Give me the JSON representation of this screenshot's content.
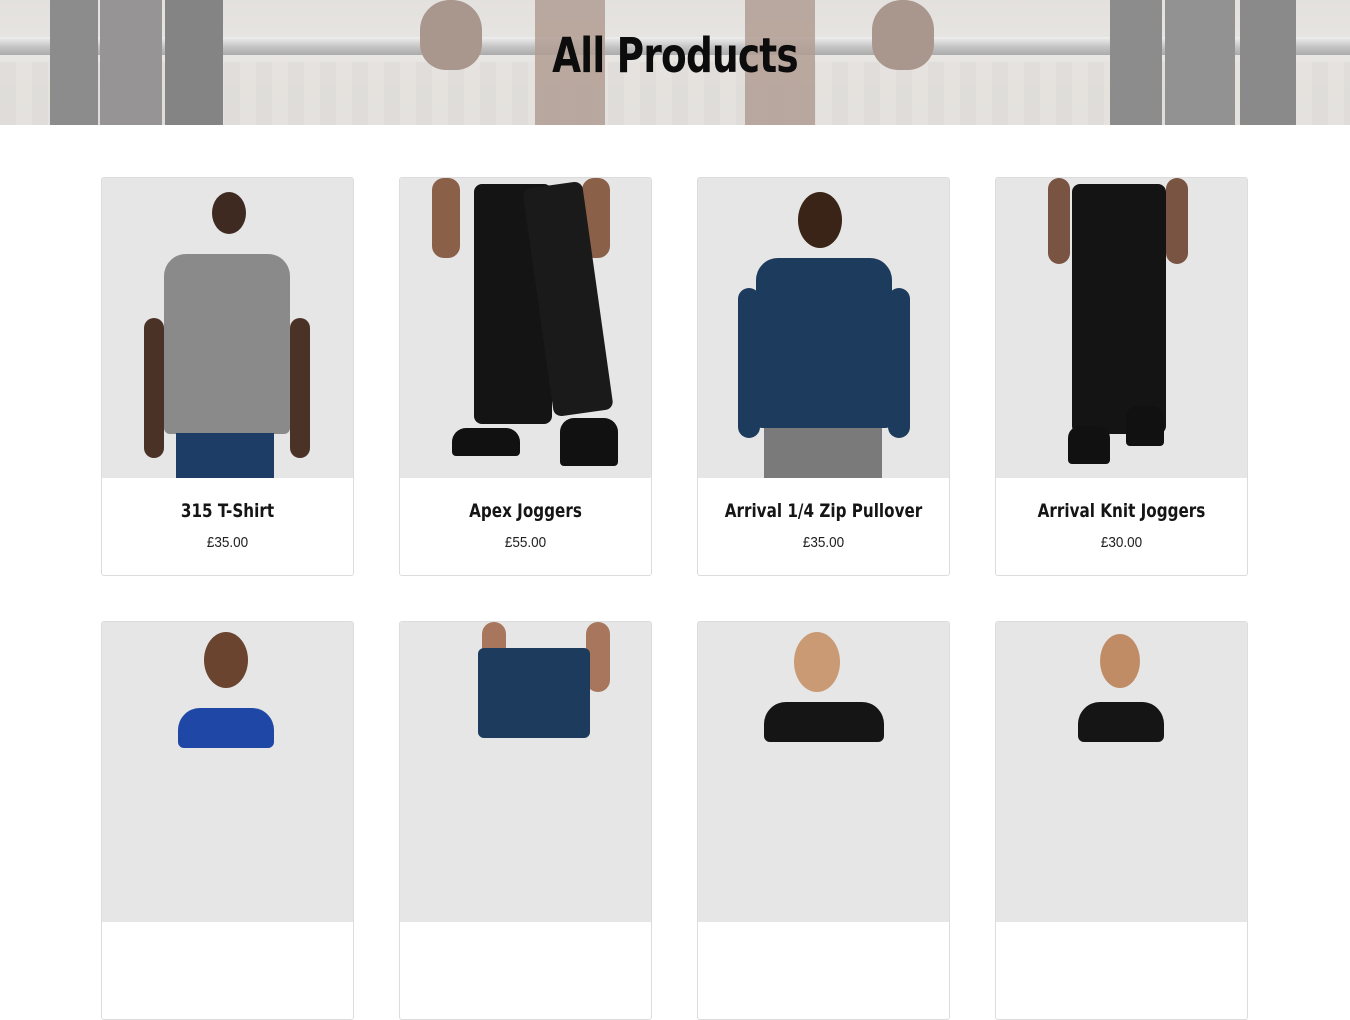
{
  "page": {
    "title": "All Products"
  },
  "products": [
    {
      "name": "315 T-Shirt",
      "price": "£35.00"
    },
    {
      "name": "Apex Joggers",
      "price": "£55.00"
    },
    {
      "name": "Arrival 1/4 Zip Pullover",
      "price": "£35.00"
    },
    {
      "name": "Arrival Knit Joggers",
      "price": "£30.00"
    },
    {
      "name": "",
      "price": ""
    },
    {
      "name": "",
      "price": ""
    },
    {
      "name": "",
      "price": ""
    },
    {
      "name": "",
      "price": ""
    }
  ],
  "colors": {
    "card_image_bg": "#e6e6e6",
    "card_border": "#dcdcdc",
    "title": "#0c0c0c"
  }
}
